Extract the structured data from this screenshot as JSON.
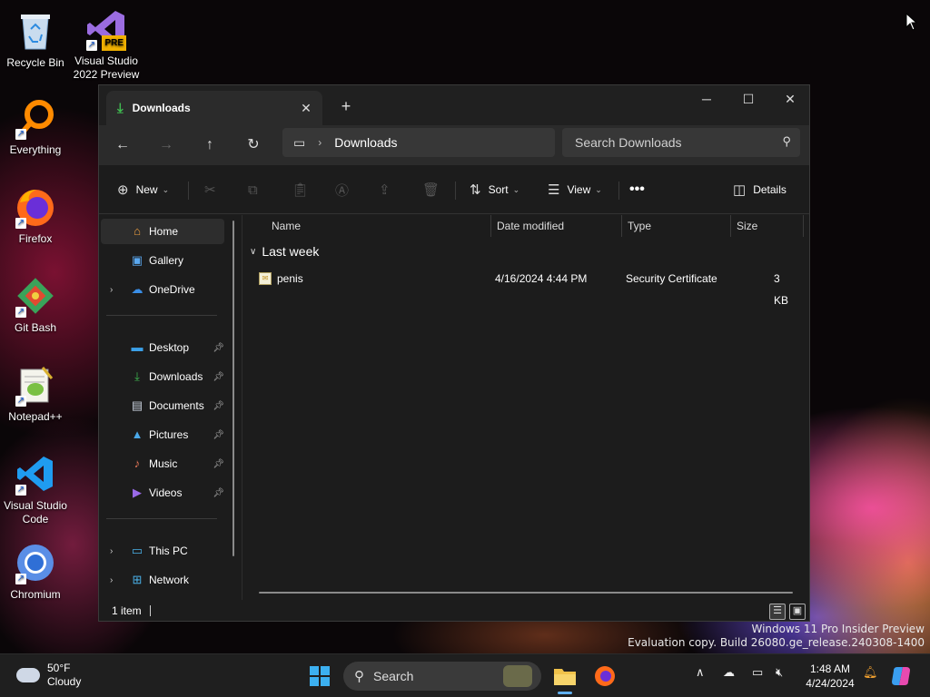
{
  "desktop": {
    "icons": [
      {
        "label": "Recycle Bin",
        "icon": "recycle-bin-icon"
      },
      {
        "label": "Visual Studio 2022 Preview",
        "badge": "PRE",
        "icon": "visual-studio-icon"
      },
      {
        "label": "Everything",
        "icon": "everything-search-icon"
      },
      {
        "label": "Firefox",
        "icon": "firefox-icon"
      },
      {
        "label": "Git Bash",
        "icon": "git-bash-icon"
      },
      {
        "label": "Notepad++",
        "icon": "notepadpp-icon"
      },
      {
        "label": "Visual Studio Code",
        "icon": "vscode-icon"
      },
      {
        "label": "Chromium",
        "icon": "chromium-icon"
      }
    ],
    "watermark": {
      "line1": "Windows 11 Pro Insider Preview",
      "line2": "Evaluation copy. Build 26080.ge_release.240308-1400"
    }
  },
  "explorer": {
    "tab": {
      "title": "Downloads"
    },
    "address": {
      "crumb": "Downloads"
    },
    "search": {
      "placeholder": "Search Downloads"
    },
    "commands": {
      "new": "New",
      "sort": "Sort",
      "view": "View",
      "details": "Details"
    },
    "sidebar": {
      "home": "Home",
      "gallery": "Gallery",
      "onedrive": "OneDrive",
      "desktop": "Desktop",
      "downloads": "Downloads",
      "documents": "Documents",
      "pictures": "Pictures",
      "music": "Music",
      "videos": "Videos",
      "thispc": "This PC",
      "network": "Network"
    },
    "columns": {
      "name": "Name",
      "date": "Date modified",
      "type": "Type",
      "size": "Size"
    },
    "group": "Last week",
    "files": [
      {
        "name": "penis",
        "date": "4/16/2024 4:44 PM",
        "type": "Security Certificate",
        "size": "3 KB"
      }
    ],
    "status": "1 item"
  },
  "taskbar": {
    "weather": {
      "temp": "50°F",
      "condition": "Cloudy"
    },
    "search_placeholder": "Search",
    "clock": {
      "time": "1:48 AM",
      "date": "4/24/2024"
    }
  },
  "colors": {
    "accent": "#0078d4",
    "folder_yellow": "#f0c24a",
    "download_green": "#3fb950"
  }
}
